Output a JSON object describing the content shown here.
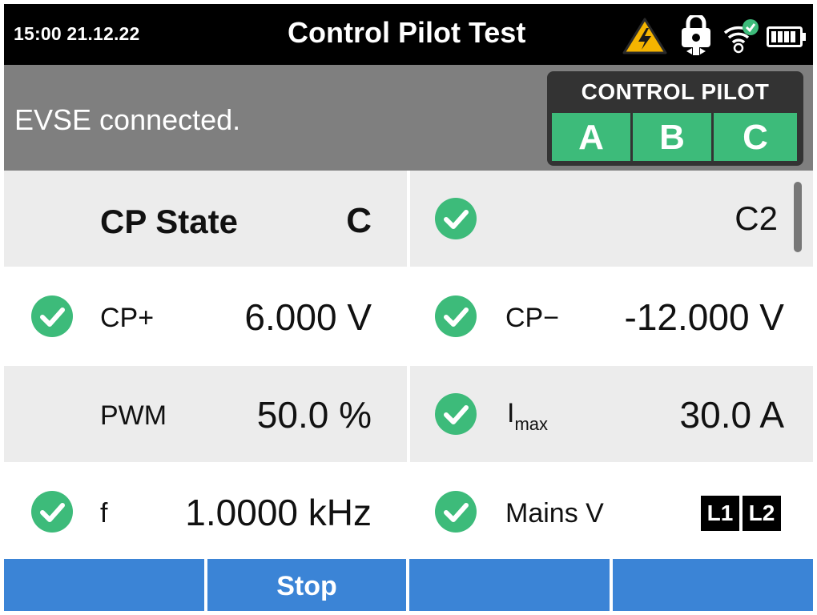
{
  "status_bar": {
    "datetime": "15:00 21.12.22",
    "title": "Control Pilot Test",
    "icons": [
      "high-voltage-warning-icon",
      "lock-icon",
      "wifi-connected-icon",
      "battery-icon"
    ]
  },
  "banner": {
    "message": "EVSE connected.",
    "control_pilot": {
      "title": "CONTROL PILOT",
      "states": [
        "A",
        "B",
        "C"
      ],
      "active_color": "#3dbb7a"
    }
  },
  "measurements": {
    "cp_state": {
      "label": "CP State",
      "value": "C",
      "code": "C2"
    },
    "cp_plus": {
      "label": "CP+",
      "value": "6.000 V"
    },
    "cp_minus": {
      "label": "CP−",
      "value": "-12.000 V"
    },
    "pwm": {
      "label": "PWM",
      "value": "50.0 %"
    },
    "imax": {
      "label": "I",
      "label_sub": "max",
      "value": "30.0 A"
    },
    "freq": {
      "label": "f",
      "value": "1.0000 kHz"
    },
    "mains": {
      "label": "Mains V",
      "phases": [
        "L1",
        "L2"
      ]
    }
  },
  "softkeys": [
    "",
    "Stop",
    "",
    ""
  ],
  "colors": {
    "ok_green": "#3dbb7a",
    "softkey_blue": "#3b84d6",
    "banner_gray": "#7f7f7f"
  }
}
